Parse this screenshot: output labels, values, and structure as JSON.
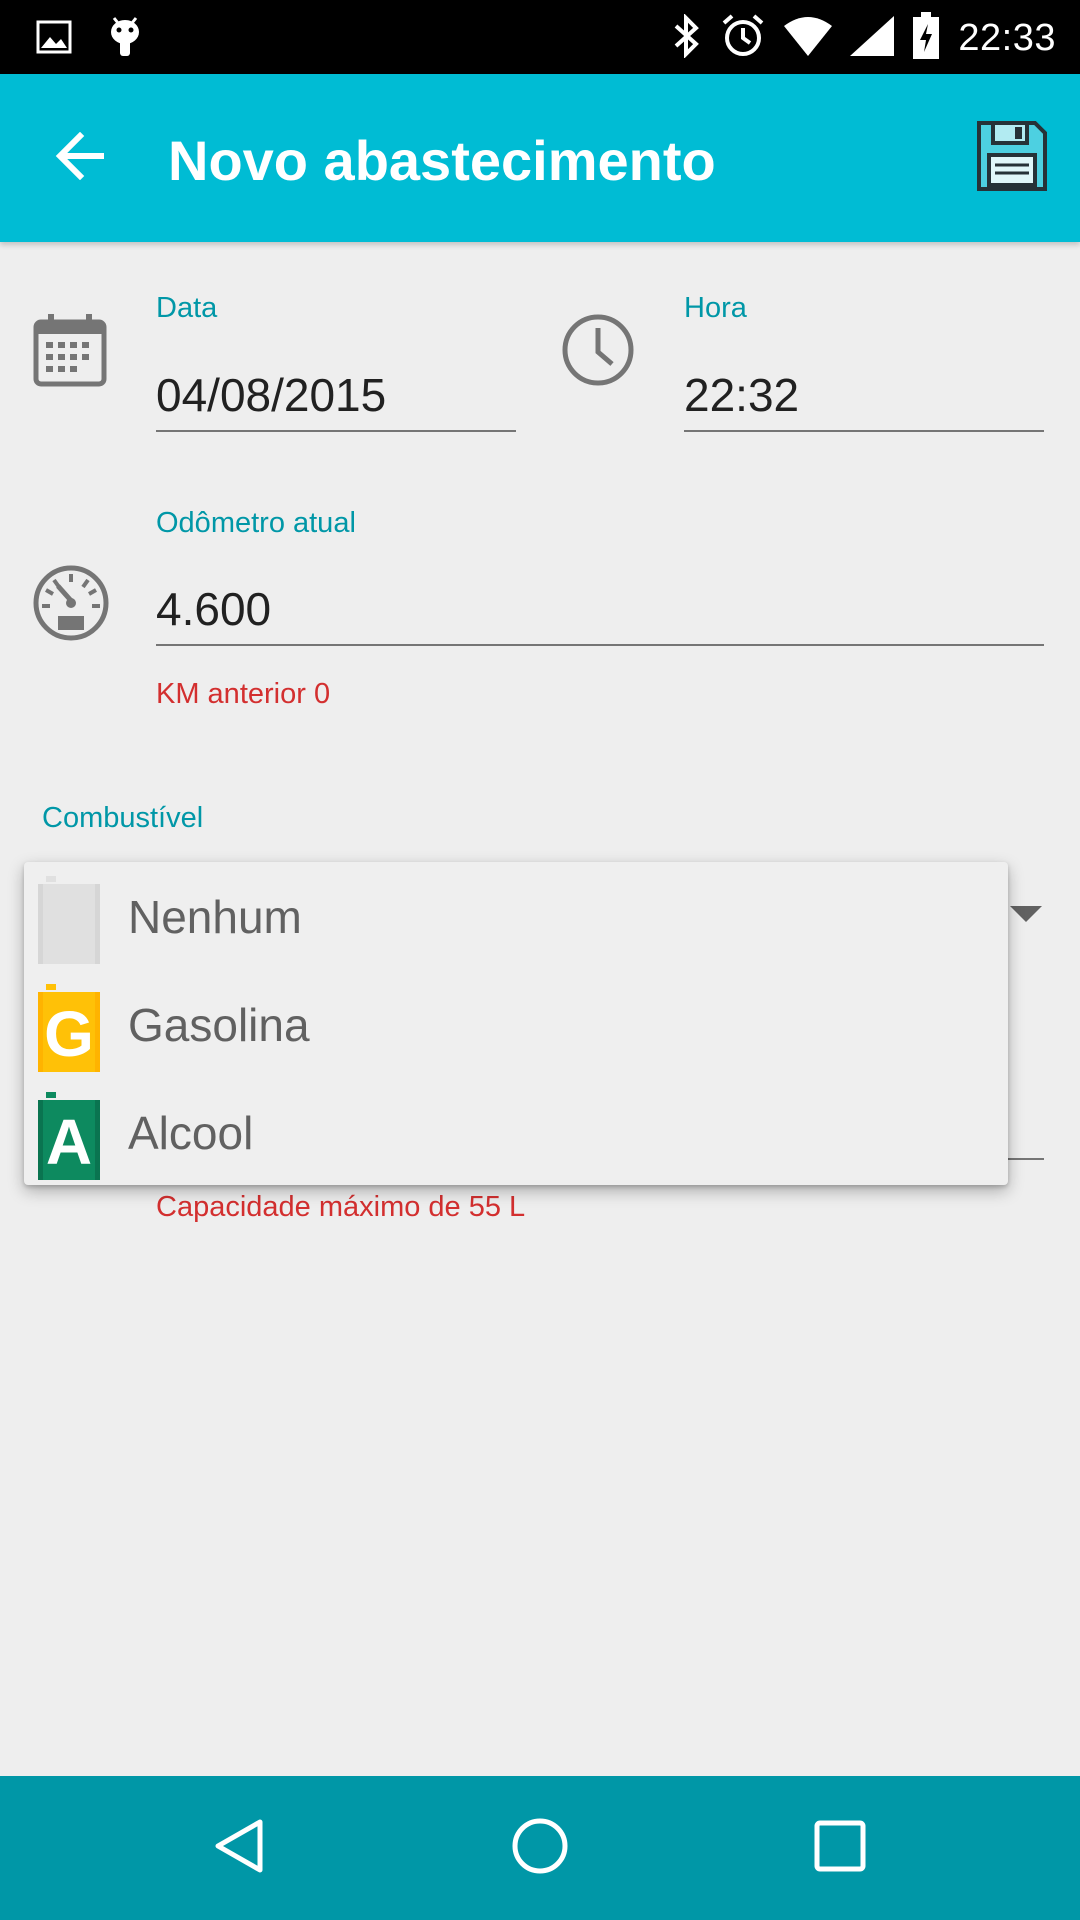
{
  "status_bar": {
    "time": "22:33",
    "icons": [
      "gallery-icon",
      "android-debug-icon",
      "bluetooth-icon",
      "alarm-icon",
      "wifi-icon",
      "signal-icon",
      "battery-charging-icon"
    ]
  },
  "app_bar": {
    "title": "Novo abastecimento",
    "back_icon": "arrow-back-icon",
    "save_icon": "floppy-save-icon"
  },
  "form": {
    "date": {
      "label": "Data",
      "value": "04/08/2015",
      "icon": "calendar-icon"
    },
    "time": {
      "label": "Hora",
      "value": "22:32",
      "icon": "clock-icon"
    },
    "odometer": {
      "label": "Odômetro atual",
      "value": "4.600",
      "hint": "KM anterior 0",
      "icon": "speedometer-icon"
    },
    "fuel": {
      "label": "Combustível"
    },
    "capacity_hint": "Capacidade máximo de 55 L"
  },
  "fuel_dropdown": {
    "options": [
      {
        "label": "Nenhum",
        "letter": "",
        "color": "#e0e0e0"
      },
      {
        "label": "Gasolina",
        "letter": "G",
        "color": "#ffc107"
      },
      {
        "label": "Alcool",
        "letter": "A",
        "color": "#0d8a5f"
      }
    ]
  },
  "colors": {
    "primary": "#00bcd4",
    "primary_dark": "#0097a7",
    "error": "#d32f2f"
  }
}
